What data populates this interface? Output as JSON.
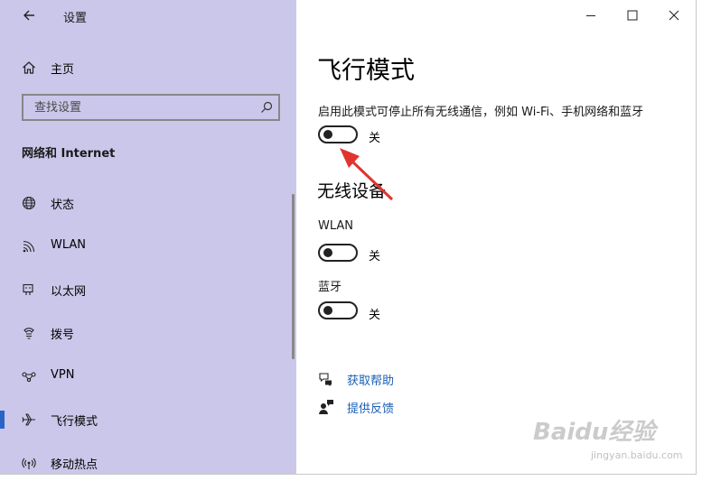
{
  "window": {
    "app_title": "设置",
    "controls": {
      "minimize": "minimize",
      "maximize": "maximize",
      "close": "close"
    }
  },
  "sidebar": {
    "home_label": "主页",
    "search": {
      "placeholder": "查找设置"
    },
    "section_title": "网络和 Internet",
    "items": [
      {
        "label": "状态",
        "icon": "globe-icon"
      },
      {
        "label": "WLAN",
        "icon": "wifi-icon"
      },
      {
        "label": "以太网",
        "icon": "ethernet-icon"
      },
      {
        "label": "拨号",
        "icon": "dialup-icon"
      },
      {
        "label": "VPN",
        "icon": "vpn-icon"
      },
      {
        "label": "飞行模式",
        "icon": "airplane-icon",
        "active": true
      },
      {
        "label": "移动热点",
        "icon": "hotspot-icon"
      }
    ]
  },
  "main": {
    "title": "飞行模式",
    "description": "启用此模式可停止所有无线通信，例如 Wi-Fi、手机网络和蓝牙",
    "airplane_toggle": {
      "state": "关",
      "on": false
    },
    "wireless_heading": "无线设备",
    "wlan": {
      "label": "WLAN",
      "state": "关",
      "on": false
    },
    "bluetooth": {
      "label": "蓝牙",
      "state": "关",
      "on": false
    },
    "links": [
      {
        "label": "获取帮助",
        "icon": "help-icon"
      },
      {
        "label": "提供反馈",
        "icon": "feedback-icon"
      }
    ]
  },
  "watermark": {
    "brand": "Baidu经验",
    "url": "jingyan.baidu.com"
  },
  "colors": {
    "sidebar_bg": "#cac7ea",
    "accent": "#2a64c8",
    "link": "#1a5fb4",
    "arrow": "#e0352e"
  }
}
